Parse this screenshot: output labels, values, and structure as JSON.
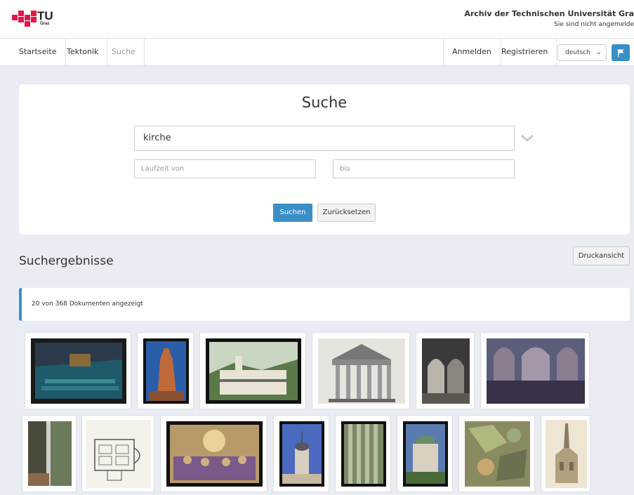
{
  "header": {
    "logo_text": "TU",
    "logo_subtext": "Graz",
    "archive_title": "Archiv der Technischen Universität Gra",
    "login_status": "Sie sind nicht angemelde"
  },
  "nav": {
    "items": [
      {
        "label": "Startseite"
      },
      {
        "label": "Tektonik"
      },
      {
        "label": "Suche"
      }
    ],
    "login_label": "Anmelden",
    "register_label": "Registrieren",
    "language": "deutsch"
  },
  "search": {
    "title": "Suche",
    "query_value": "kirche",
    "date_from_placeholder": "Laufzeit von",
    "date_to_placeholder": "bis",
    "search_button": "Suchen",
    "reset_button": "Zurücksetzen"
  },
  "results": {
    "title": "Suchergebnisse",
    "print_button": "Druckansicht",
    "info_text": "20 von 368 Dokumenten angezeigt",
    "thumbnails": [
      {
        "subject": "modern-church-interior"
      },
      {
        "subject": "church-tower"
      },
      {
        "subject": "modern-building"
      },
      {
        "subject": "classical-portico"
      },
      {
        "subject": "church-interior-arches"
      },
      {
        "subject": "gothic-nave"
      },
      {
        "subject": "window-detail"
      },
      {
        "subject": "floor-plan"
      },
      {
        "subject": "fresco-painting"
      },
      {
        "subject": "onion-dome-tower"
      },
      {
        "subject": "gothic-portal"
      },
      {
        "subject": "domed-chapel"
      },
      {
        "subject": "stained-glass"
      },
      {
        "subject": "gothic-spire-drawing"
      }
    ]
  },
  "colors": {
    "accent": "#3a8fc7",
    "brand_red": "#e4154b",
    "background": "#e9ecf2"
  }
}
